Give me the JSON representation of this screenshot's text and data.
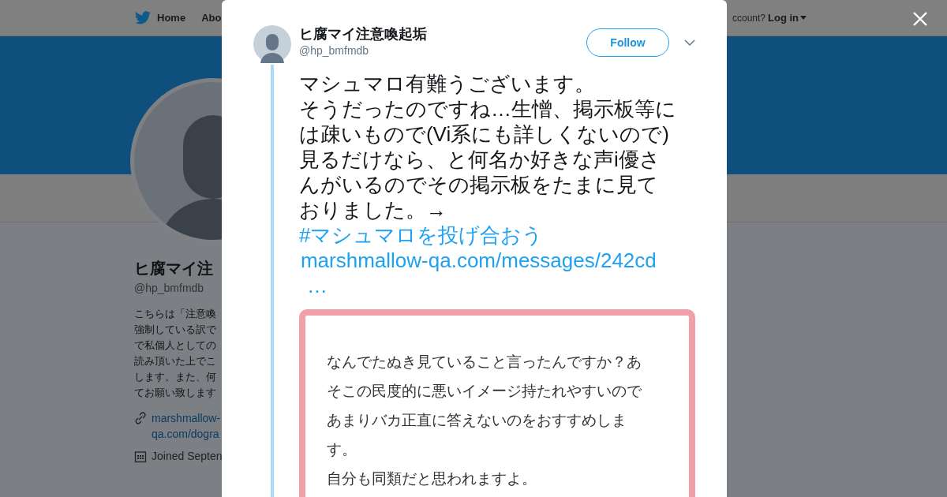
{
  "background": {
    "nav": {
      "home": "Home",
      "about": "Abo",
      "account_prompt": "ccount?",
      "login": "Log in"
    },
    "profile": {
      "name": "ヒ腐マイ注",
      "handle": "@hp_bmfmdb",
      "bio_lines": [
        "こちらは「注意喚",
        "強制している訳で",
        "で私個人としての",
        "読み頂いた上でこ",
        "します。また、何",
        "てお願い致します"
      ],
      "link_lines": [
        "marshmallow-",
        "qa.com/dogra"
      ],
      "joined": "Joined Septen"
    }
  },
  "tweet": {
    "author": "ヒ腐マイ注意喚起垢",
    "handle": "@hp_bmfmdb",
    "follow": "Follow",
    "text_lines": [
      "マシュマロ有難うございます。",
      "そうだったのですね…生憎、掲示板等に",
      "は疎いもので(Vi系にも詳しくないので)",
      "見るだけなら、と何名か好きな声i優さ",
      "んがいるのでその掲示板をたまに見て",
      "おりました。→"
    ],
    "hashtag": "#マシュマロを投げ合おう",
    "url": "marshmallow-qa.com/messages/242cd",
    "url_more": "…",
    "card_lines": [
      "なんでたぬき見ていること言ったんですか？あ",
      "そこの民度的に悪いイメージ持たれやすいので",
      "あまりバカ正直に答えないのをおすすめしま",
      "す。",
      "自分も同類だと思われますよ。"
    ]
  }
}
